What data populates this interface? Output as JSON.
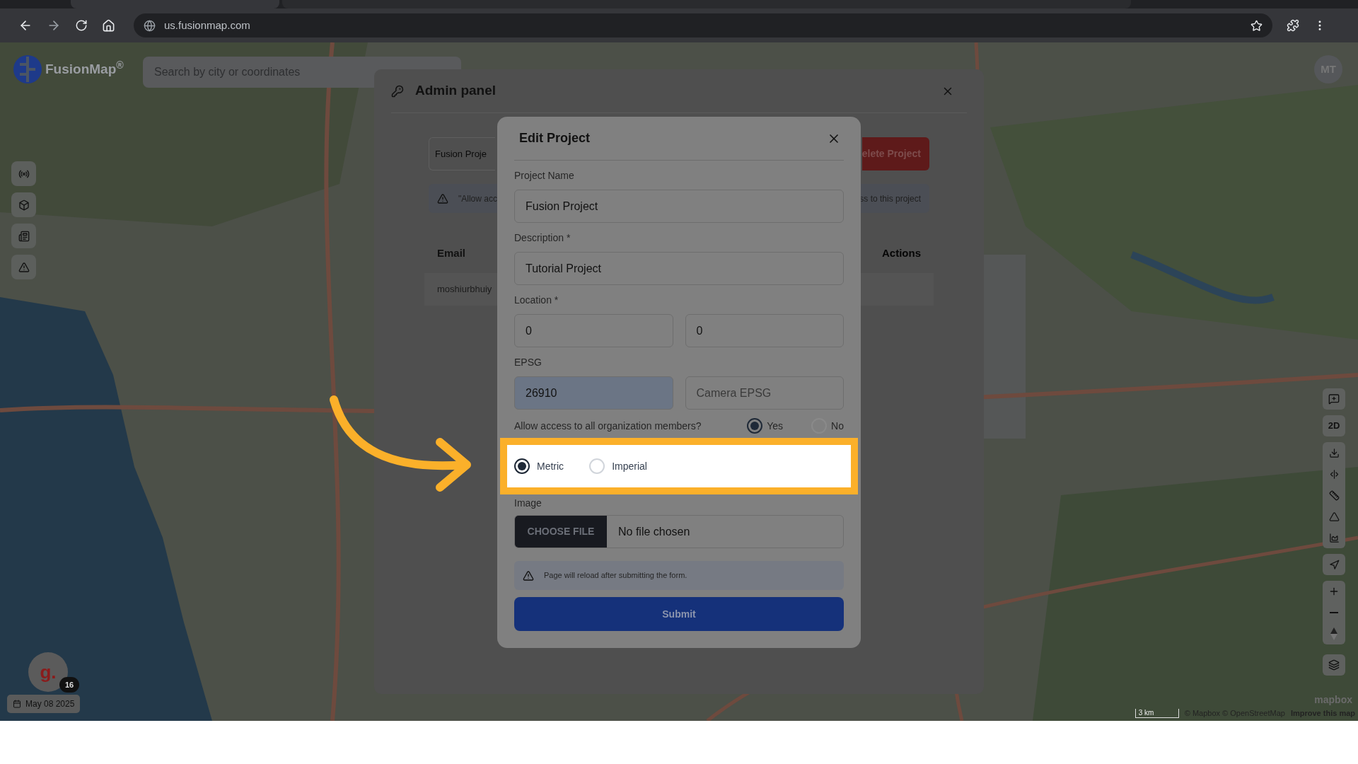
{
  "browser": {
    "url": "us.fusionmap.com"
  },
  "app": {
    "logo": "FusionMap$^{®}$",
    "search_placeholder": "Search by city or coordinates",
    "avatar": "MT",
    "map_mode": "2D",
    "user_initial": "g.",
    "notification_count": "16",
    "date": "May 08 2025",
    "scale": "3 km",
    "logo_text": "mapbox",
    "attribution": "© Mapbox © OpenStreetMap",
    "attribution_link": "Improve this map"
  },
  "admin_panel": {
    "title": "Admin panel",
    "project_field": "Fusion Proje",
    "delete_button": "elete Project",
    "notice_left": "\"Allow acc",
    "notice_right": "ss to this project",
    "columns": [
      "Email",
      "Actions"
    ],
    "row_email": "moshiurbhuiy"
  },
  "dialog": {
    "title": "Edit Project",
    "fields": [
      {
        "label": "Project Name",
        "value": "Fusion Project"
      },
      {
        "label": "Description *",
        "value": "Tutorial Project"
      }
    ],
    "location": {
      "label": "Location *",
      "values": [
        "0",
        "0"
      ]
    },
    "epsg": {
      "label": "EPSG",
      "value": "26910",
      "placeholder": "Camera EPSG"
    },
    "access": {
      "label": "Allow access to all organization members?",
      "options": [
        {
          "label": "Yes",
          "selected": true
        },
        {
          "label": "No",
          "selected": false
        }
      ]
    },
    "units": [
      {
        "label": "Metric",
        "selected": true
      },
      {
        "label": "Imperial",
        "selected": false
      }
    ],
    "image": {
      "label": "Image",
      "button": "CHOOSE FILE",
      "status": "No file chosen"
    },
    "notice": "Page will reload after submitting the form.",
    "submit": "Submit"
  }
}
